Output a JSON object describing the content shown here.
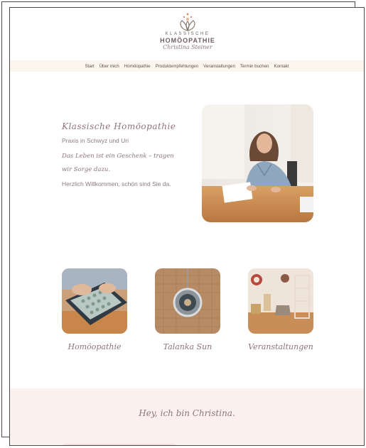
{
  "logo": {
    "line1": "KLASSISCHE",
    "line2": "HOMÖOPATHIE",
    "signature": "Christina Steiner"
  },
  "nav": {
    "items": [
      "Start",
      "Über mich",
      "Homöopathie",
      "Produktempfehlungen",
      "Veranstaltungen",
      "Termin buchen",
      "Kontakt"
    ]
  },
  "hero": {
    "title": "Klassische Homöopathie",
    "subtitle": "Praxis in Schwyz und Uri",
    "quote": "Das Leben ist ein Geschenk – tragen wir Sorge dazu.",
    "welcome": "Herzlich Willkommen, schön sind Sie da."
  },
  "tiles": [
    {
      "caption": "Homöopathie"
    },
    {
      "caption": "Talanka Sun"
    },
    {
      "caption": "Veranstaltungen"
    }
  ],
  "about": {
    "title": "Hey, ich bin Christina."
  },
  "colors": {
    "nav_bg": "#fdf6ec",
    "accent_text": "#8d7478",
    "section_bg": "#fcf1ee"
  }
}
